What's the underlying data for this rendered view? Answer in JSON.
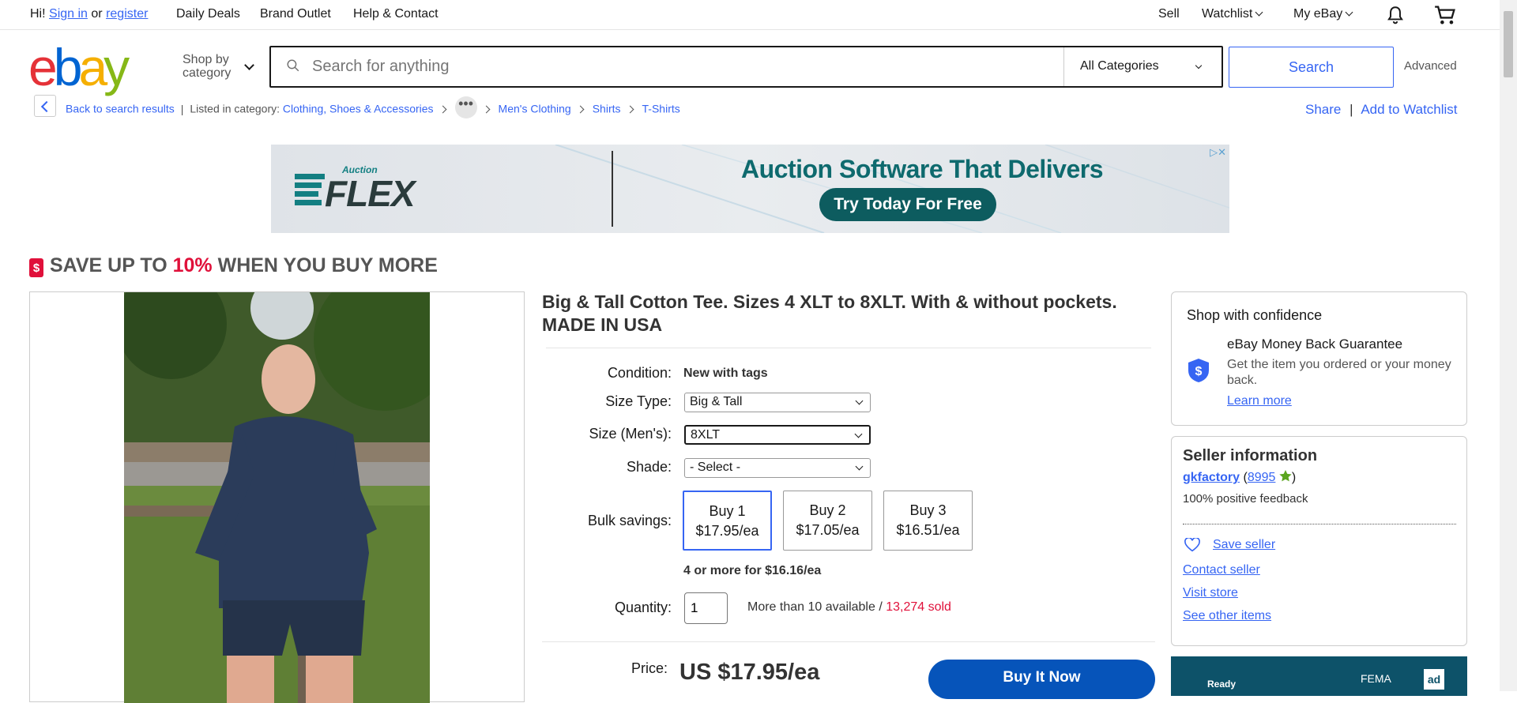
{
  "topnav": {
    "greeting": "Hi!",
    "sign_in": "Sign in",
    "or": "or",
    "register": "register",
    "daily_deals": "Daily Deals",
    "brand_outlet": "Brand Outlet",
    "help": "Help & Contact",
    "sell": "Sell",
    "watchlist": "Watchlist",
    "my_ebay": "My eBay"
  },
  "logo": [
    "e",
    "b",
    "a",
    "y"
  ],
  "header": {
    "shop_by_line1": "Shop by",
    "shop_by_line2": "category",
    "search_placeholder": "Search for anything",
    "category": "All Categories",
    "search_button": "Search",
    "advanced": "Advanced"
  },
  "breadcrumb": {
    "back": "Back to search results",
    "listed_in": "Listed in category:",
    "items": [
      "Clothing, Shoes & Accessories",
      "Men's Clothing",
      "Shirts",
      "T-Shirts"
    ],
    "share": "Share",
    "divider": "|",
    "add_watchlist": "Add to Watchlist"
  },
  "ad": {
    "brand_small": "Auction",
    "brand": "FLEX",
    "headline": "Auction Software That Delivers",
    "cta": "Try Today For Free"
  },
  "promo_banner": {
    "pre": "SAVE UP TO ",
    "pct": "10%",
    "post": " WHEN YOU BUY MORE",
    "icon_glyph": "$"
  },
  "listing": {
    "title": "Big & Tall Cotton Tee. Sizes 4 XLT to 8XLT. With & without pockets. MADE IN USA",
    "condition_label": "Condition:",
    "condition_value": "New with tags",
    "size_type_label": "Size Type:",
    "size_type_value": "Big & Tall",
    "size_label": "Size (Men's):",
    "size_value": "8XLT",
    "shade_label": "Shade:",
    "shade_value": "- Select -",
    "bulk_label": "Bulk savings:",
    "bulk": [
      {
        "qty": "Buy 1",
        "price": "$17.95/ea"
      },
      {
        "qty": "Buy 2",
        "price": "$17.05/ea"
      },
      {
        "qty": "Buy 3",
        "price": "$16.51/ea"
      }
    ],
    "bulk_more": "4 or more for $16.16/ea",
    "quantity_label": "Quantity:",
    "quantity_value": "1",
    "availability": "More than 10 available / ",
    "sold": "13,274 sold",
    "price_label": "Price:",
    "price": "US $17.95/ea",
    "buy_now": "Buy It Now"
  },
  "confidence": {
    "title": "Shop with confidence",
    "guarantee_title": "eBay Money Back Guarantee",
    "guarantee_text": "Get the item you ordered or your money back.",
    "learn_more": "Learn more",
    "icon_glyph": "$"
  },
  "seller": {
    "title": "Seller information",
    "name": "gkfactory",
    "open": " (",
    "score": "8995",
    "close": ")",
    "feedback": "100% positive feedback",
    "save": "Save seller",
    "contact": "Contact seller",
    "visit": "Visit store",
    "other": "See other items"
  },
  "side_promo": {
    "left": "Ready",
    "fema": "FEMA",
    "ad": "ad"
  },
  "colors": {
    "link": "#3665f3",
    "sale_red": "#e0103a",
    "buy_button": "#0654ba"
  }
}
